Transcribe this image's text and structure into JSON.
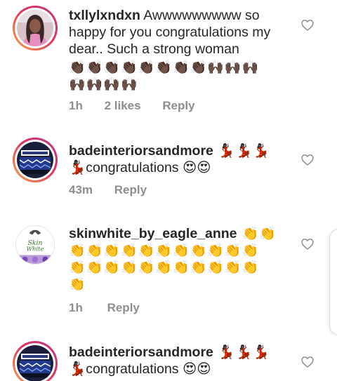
{
  "comments": [
    {
      "username": "txllylxndxn",
      "text": " Awwwwwwwww so happy for you congratulations my dear.. Such a strong woman",
      "emoji": "👏🏿👏🏿👏🏿👏🏿👏🏿👏🏿👏🏿👏🏿🙌🏿🙌🏿🙌🏿🙌🏿🙌🏿🙌🏿🙌🏿",
      "time": "1h",
      "likes": "2 likes",
      "reply": "Reply",
      "avatar": "woman-portrait",
      "icon": "heart-outline-icon"
    },
    {
      "username": "badeinteriorsandmore",
      "emoji_inline": " 💃🏿💃🏿💃🏿",
      "text": "💃🏿congratulations 😍😍",
      "time": "43m",
      "reply": "Reply",
      "avatar": "bed-logo",
      "icon": "heart-outline-icon"
    },
    {
      "username": "skinwhite_by_eagle_anne",
      "emoji_inline": " 👏👏",
      "emoji": "👏👏👏👏👏👏👏👏👏👏👏👏👏👏👏👏👏👏👏👏👏👏👏",
      "time": "1h",
      "reply": "Reply",
      "avatar": "skin-white-logo",
      "icon": "heart-outline-icon"
    },
    {
      "username": "badeinteriorsandmore",
      "emoji_inline": " 💃🏿💃🏿💃🏿",
      "text": "💃🏿congratulations 😍😍",
      "avatar": "bed-logo",
      "icon": "heart-outline-icon"
    }
  ],
  "colors": {
    "username": "#262626",
    "meta": "#8e8e8e",
    "story_ring_start": "#f9a44a",
    "story_ring_end": "#c13584"
  }
}
